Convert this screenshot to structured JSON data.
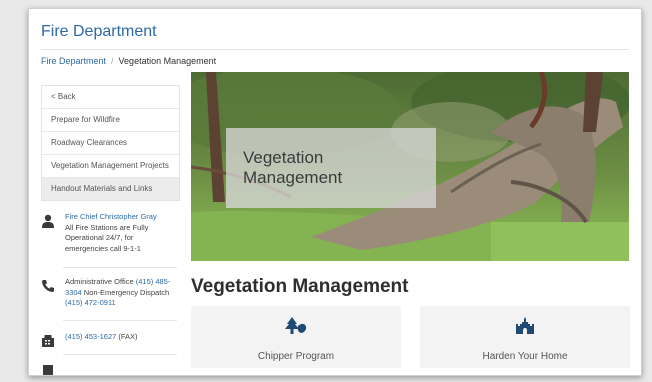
{
  "header": {
    "site_title": "Fire Department"
  },
  "breadcrumb": {
    "parent": "Fire Department",
    "current": "Vegetation Management"
  },
  "sidebar": {
    "items": [
      {
        "label": "< Back"
      },
      {
        "label": "Prepare for Wildfire"
      },
      {
        "label": "Roadway Clearances"
      },
      {
        "label": "Vegetation Management Projects"
      },
      {
        "label": "Handout Materials and Links"
      }
    ]
  },
  "contacts": {
    "chief": {
      "name": "Fire Chief Christopher Gray",
      "note": "All Fire Stations are Fully Operational 24/7, for emergencies call 9-1-1",
      "icon": "person-icon"
    },
    "office": {
      "label": "Administrative Office",
      "phone": "(415) 485-3304",
      "non_emergency_label": "Non-Emergency Dispatch",
      "dispatch_phone": "(415) 472-0911",
      "icon": "phone-icon"
    },
    "fax": {
      "phone": "(415) 453-1627",
      "label": "(FAX)",
      "icon": "fax-icon"
    }
  },
  "hero": {
    "title": "Vegetation Management"
  },
  "main": {
    "title": "Vegetation Management",
    "cards": [
      {
        "label": "Chipper Program",
        "icon": "tree-leaf-icon"
      },
      {
        "label": "Harden Your Home",
        "icon": "castle-icon"
      }
    ]
  },
  "colors": {
    "link": "#2d6aa3",
    "icon": "#1f4b73",
    "card_bg": "#f3f3f3"
  }
}
